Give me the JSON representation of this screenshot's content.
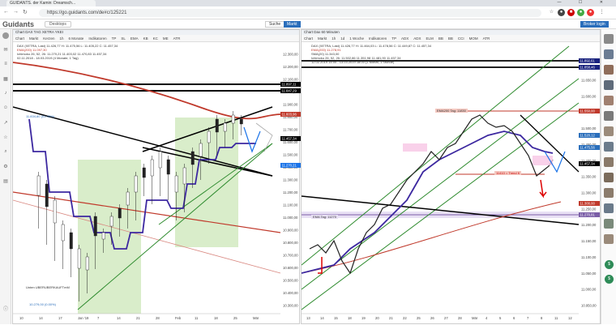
{
  "browser": {
    "tab_title": "GUIDANTS. der Kamin: Dreamsch...",
    "url": "https://go.guidants.com/de#c/125221",
    "window_buttons": "— ☐ ✕"
  },
  "app": {
    "logo": "Guidants",
    "desktop_label": "Desktops",
    "search_label": "Suche",
    "market_label": "Markt",
    "broker_label": "Broker login"
  },
  "left_chart": {
    "header": "Chart DAX TAG XETRA YKEI",
    "tools": [
      "Chart",
      "Markt",
      "Kerzen",
      "1h",
      "6 Monate",
      "Indikatoren",
      "TP",
      "SL",
      "EMA",
      "KB",
      "KC",
      "ME",
      "ATR"
    ],
    "legend": [
      "DAX (XETRA, Last) 11.426,77 H: 11.475,56 L: 11.405,22 C: 11.457,34",
      "EMA(200) 11.097,30",
      "Ichimoku 26, 52, 26: 11.270,21 11.403,02 11.470,83 11.457,34",
      "02.11.2018 - 18.03.2019 (4 Monate, 1 Tag)"
    ],
    "note_top": "11.834,80 (01.05%)",
    "note_bottom": "10.279,00 (0.00%)",
    "note_trend": "Unten UBERUBERKAUFTmM",
    "price_labels": [
      "12.300,00",
      "12.200,00",
      "12.100,00",
      "12.000,00",
      "11.900,00",
      "11.800,00",
      "11.700,00",
      "11.600,00",
      "11.500,00",
      "11.400,00",
      "11.300,00",
      "11.200,00",
      "11.100,00",
      "11.000,00",
      "10.900,00",
      "10.800,00",
      "10.700,00",
      "10.600,00",
      "10.500,00",
      "10.400,00",
      "10.300,00"
    ],
    "highlight_labels": [
      "11.897,11",
      "11.847,29",
      "11.603,96",
      "11.457,34",
      "11.270,21"
    ],
    "x_labels": [
      "10",
      "14",
      "17",
      "Jan '19",
      "7",
      "14",
      "21",
      "28",
      "Feb",
      "11",
      "18",
      "25",
      "Mär"
    ]
  },
  "right_chart": {
    "header": "Chart Dax 60 Minuten",
    "tools": [
      "Chart",
      "Markt",
      "1h",
      "1d",
      "1 Woche",
      "Indikatoren",
      "TP",
      "ADX",
      "ADX",
      "ELM",
      "BB",
      "BB",
      "CCI",
      "MOM",
      "ATR"
    ],
    "legend": [
      "DAX (XETRA, Last) 11.426,77 H: 11.464,03 L: 11.478,56 C: 11.449,87 C: 11.457,34",
      "EMA(200) 11.278,91",
      "SMA(20) 11.343,00",
      "Ichimoku 26, 52, 26: 11.502,86 11.351,98 11.481,90 11.457,34",
      "12.02.2019 14:00 - 13.03.2019 18:00 (1 Monat, 1 Stunde)"
    ],
    "annot_top": "EMA200 Tag: 11830",
    "annot_mid": "11410 = Trend K",
    "annot_low": "EMA Tag: 11270",
    "price_labels": [
      "11.650,00",
      "11.600,00",
      "11.550,00",
      "11.500,00",
      "11.450,00",
      "11.400,00",
      "11.350,00",
      "11.300,00",
      "11.250,00",
      "11.200,00",
      "11.150,00",
      "11.100,00",
      "11.050,00",
      "11.000,00",
      "10.950,00"
    ],
    "highlight_labels": [
      "11.892,61",
      "11.858,46",
      "11.550,00",
      "11.520,12",
      "11.475,56",
      "11.457,34",
      "11.300,00",
      "11.270,81"
    ],
    "x_labels": [
      "13",
      "14",
      "15",
      "18",
      "19",
      "20",
      "21",
      "22",
      "25",
      "26",
      "27",
      "28",
      "Mär",
      "4",
      "5",
      "6",
      "7",
      "8",
      "11",
      "12"
    ]
  },
  "colors": {
    "accent": "#2a6ebb",
    "green_zone": "#c8e6b4",
    "ichimoku": "#3c28a0",
    "ema": "#c0392b",
    "trend_green": "#2e8b2e"
  }
}
